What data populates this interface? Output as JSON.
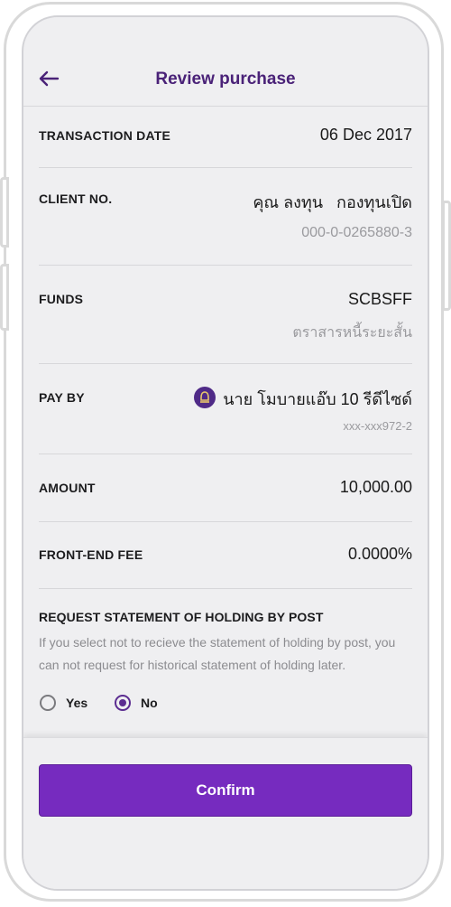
{
  "header": {
    "title": "Review purchase"
  },
  "rows": {
    "transaction_date": {
      "label": "TRANSACTION DATE",
      "value": "06 Dec 2017"
    },
    "client_no": {
      "label": "CLIENT NO.",
      "value": "คุณ ลงทุน   กองทุนเปิด",
      "sub": "000-0-0265880-3"
    },
    "funds": {
      "label": "FUNDS",
      "value": "SCBSFF",
      "sub": "ตราสารหนี้ระยะสั้น"
    },
    "pay_by": {
      "label": "PAY BY",
      "value": "นาย โมบายแอ๊บ 10 รีดีไซด์",
      "sub": "xxx-xxx972-2"
    },
    "amount": {
      "label": "AMOUNT",
      "value": "10,000.00"
    },
    "front_end_fee": {
      "label": "FRONT-END FEE",
      "value": "0.0000%"
    }
  },
  "statement": {
    "title": "REQUEST STATEMENT OF HOLDING BY POST",
    "description": "If you select not to recieve the statement of holding by post, you can not request for historical statement of holding later.",
    "options": [
      {
        "label": "Yes",
        "selected": false
      },
      {
        "label": "No",
        "selected": true
      }
    ]
  },
  "confirm_label": "Confirm",
  "colors": {
    "accent": "#5c2d91",
    "button": "#762bbf",
    "title": "#4a2278"
  }
}
